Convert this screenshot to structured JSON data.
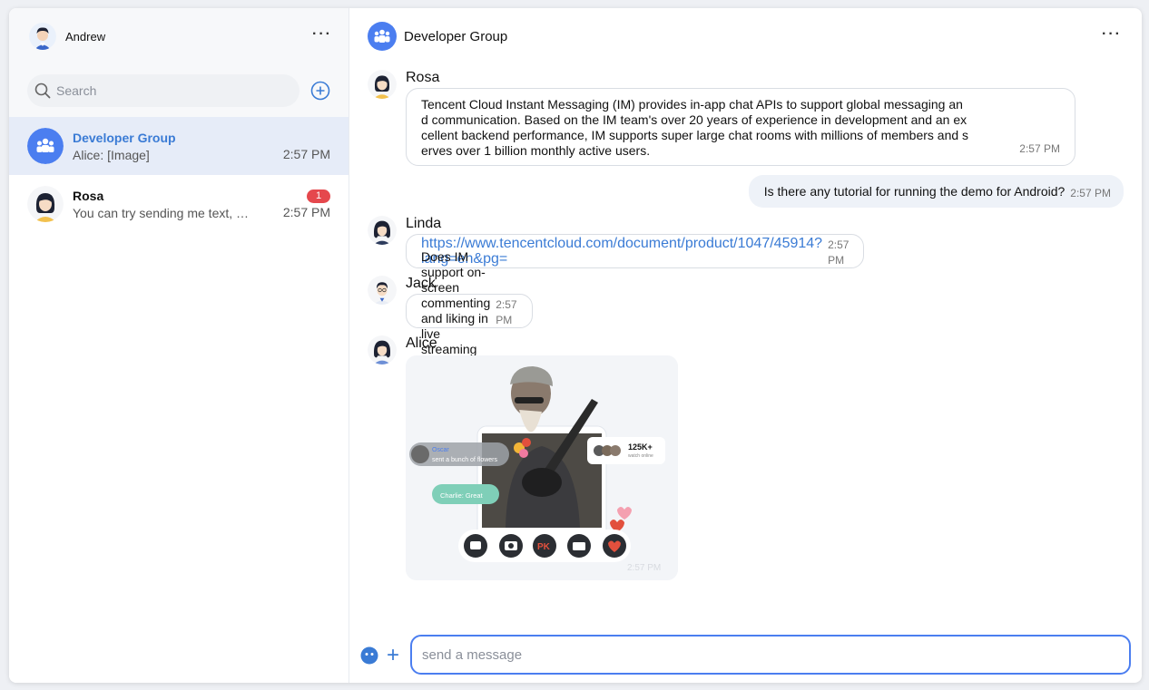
{
  "sidebar": {
    "user": {
      "name": "Andrew"
    },
    "search": {
      "placeholder": "Search"
    },
    "conversations": [
      {
        "name": "Developer Group",
        "preview": "Alice: [Image]",
        "time": "2:57 PM",
        "active": true
      },
      {
        "name": "Rosa",
        "preview": "You can try sending me text, e…",
        "time": "2:57 PM",
        "badge": "1"
      }
    ]
  },
  "chat": {
    "title": "Developer Group",
    "messages": [
      {
        "sender": "Rosa",
        "lines": [
          "Tencent Cloud Instant Messaging (IM) provides in-app chat APIs to support global messaging an",
          "d communication. Based on the IM team's over 20 years of experience in development and an ex",
          "cellent backend performance, IM supports super large chat rooms with millions of members and s",
          "erves over 1 billion monthly active users."
        ],
        "time": "2:57 PM"
      },
      {
        "sender": "self",
        "text": "Is there any tutorial for running the demo for Android?",
        "time": "2:57 PM"
      },
      {
        "sender": "Linda",
        "text": "https://www.tencentcloud.com/document/product/1047/45914?lang=en&pg=",
        "time": "2:57 PM"
      },
      {
        "sender": "Jack",
        "text": "Does IM support on-screen commenting and liking in live streaming use cases?",
        "time": "2:57 PM"
      },
      {
        "sender": "Alice",
        "image": {
          "overlay_name": "Oscar",
          "overlay_action": "sent a bunch of flowers",
          "comment": "Charlie: Great",
          "viewers": "125K+",
          "viewers_sub": "watch online",
          "pk": "PK"
        },
        "time": "2:57 PM"
      }
    ],
    "composer": {
      "placeholder": "send a message"
    }
  },
  "colors": {
    "accent": "#4b7ef0",
    "badge": "#e5484d",
    "link": "#3a7bd5"
  }
}
